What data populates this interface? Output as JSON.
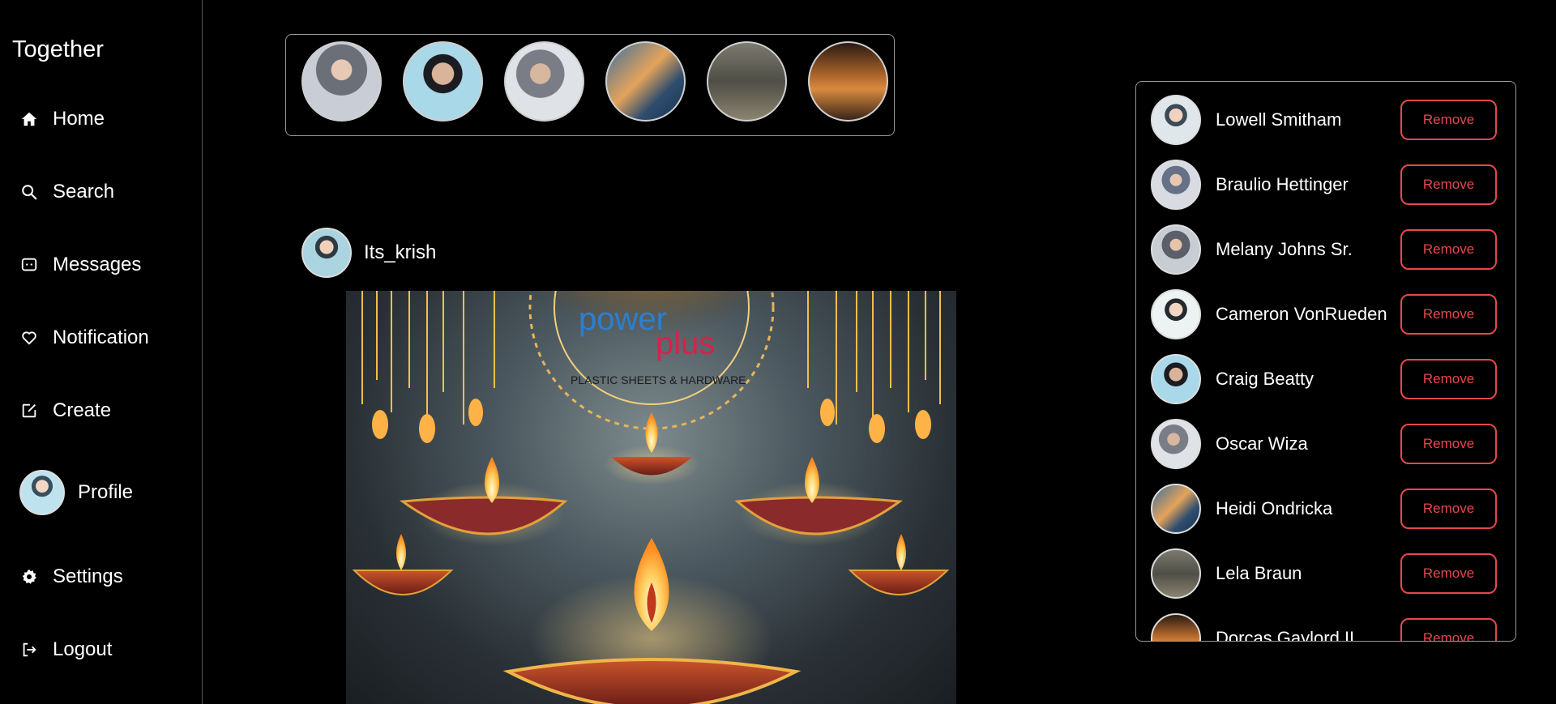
{
  "app": {
    "title": "Together"
  },
  "nav": {
    "items": [
      {
        "label": "Home",
        "icon": "home-icon"
      },
      {
        "label": "Search",
        "icon": "search-icon"
      },
      {
        "label": "Messages",
        "icon": "message-icon"
      },
      {
        "label": "Notification",
        "icon": "heart-icon"
      },
      {
        "label": "Create",
        "icon": "create-icon"
      },
      {
        "label": "Profile",
        "icon": "avatar"
      },
      {
        "label": "Settings",
        "icon": "gear-icon"
      },
      {
        "label": "Logout",
        "icon": "logout-icon"
      }
    ]
  },
  "stories": {
    "count": 6
  },
  "post": {
    "author": "Its_krish",
    "image_text": {
      "brand_line1": "power",
      "brand_line2": "plus",
      "tagline": "PLASTIC SHEETS & HARDWARE"
    }
  },
  "friends": {
    "remove_label": "Remove",
    "items": [
      {
        "name": "Lowell Smitham"
      },
      {
        "name": "Braulio Hettinger"
      },
      {
        "name": "Melany Johns Sr."
      },
      {
        "name": "Cameron VonRueden"
      },
      {
        "name": "Craig Beatty"
      },
      {
        "name": "Oscar Wiza"
      },
      {
        "name": "Heidi Ondricka"
      },
      {
        "name": "Lela Braun"
      },
      {
        "name": "Dorcas Gaylord II"
      }
    ]
  },
  "colors": {
    "background": "#000000",
    "remove_accent": "#e5484d",
    "text": "#ffffff"
  }
}
